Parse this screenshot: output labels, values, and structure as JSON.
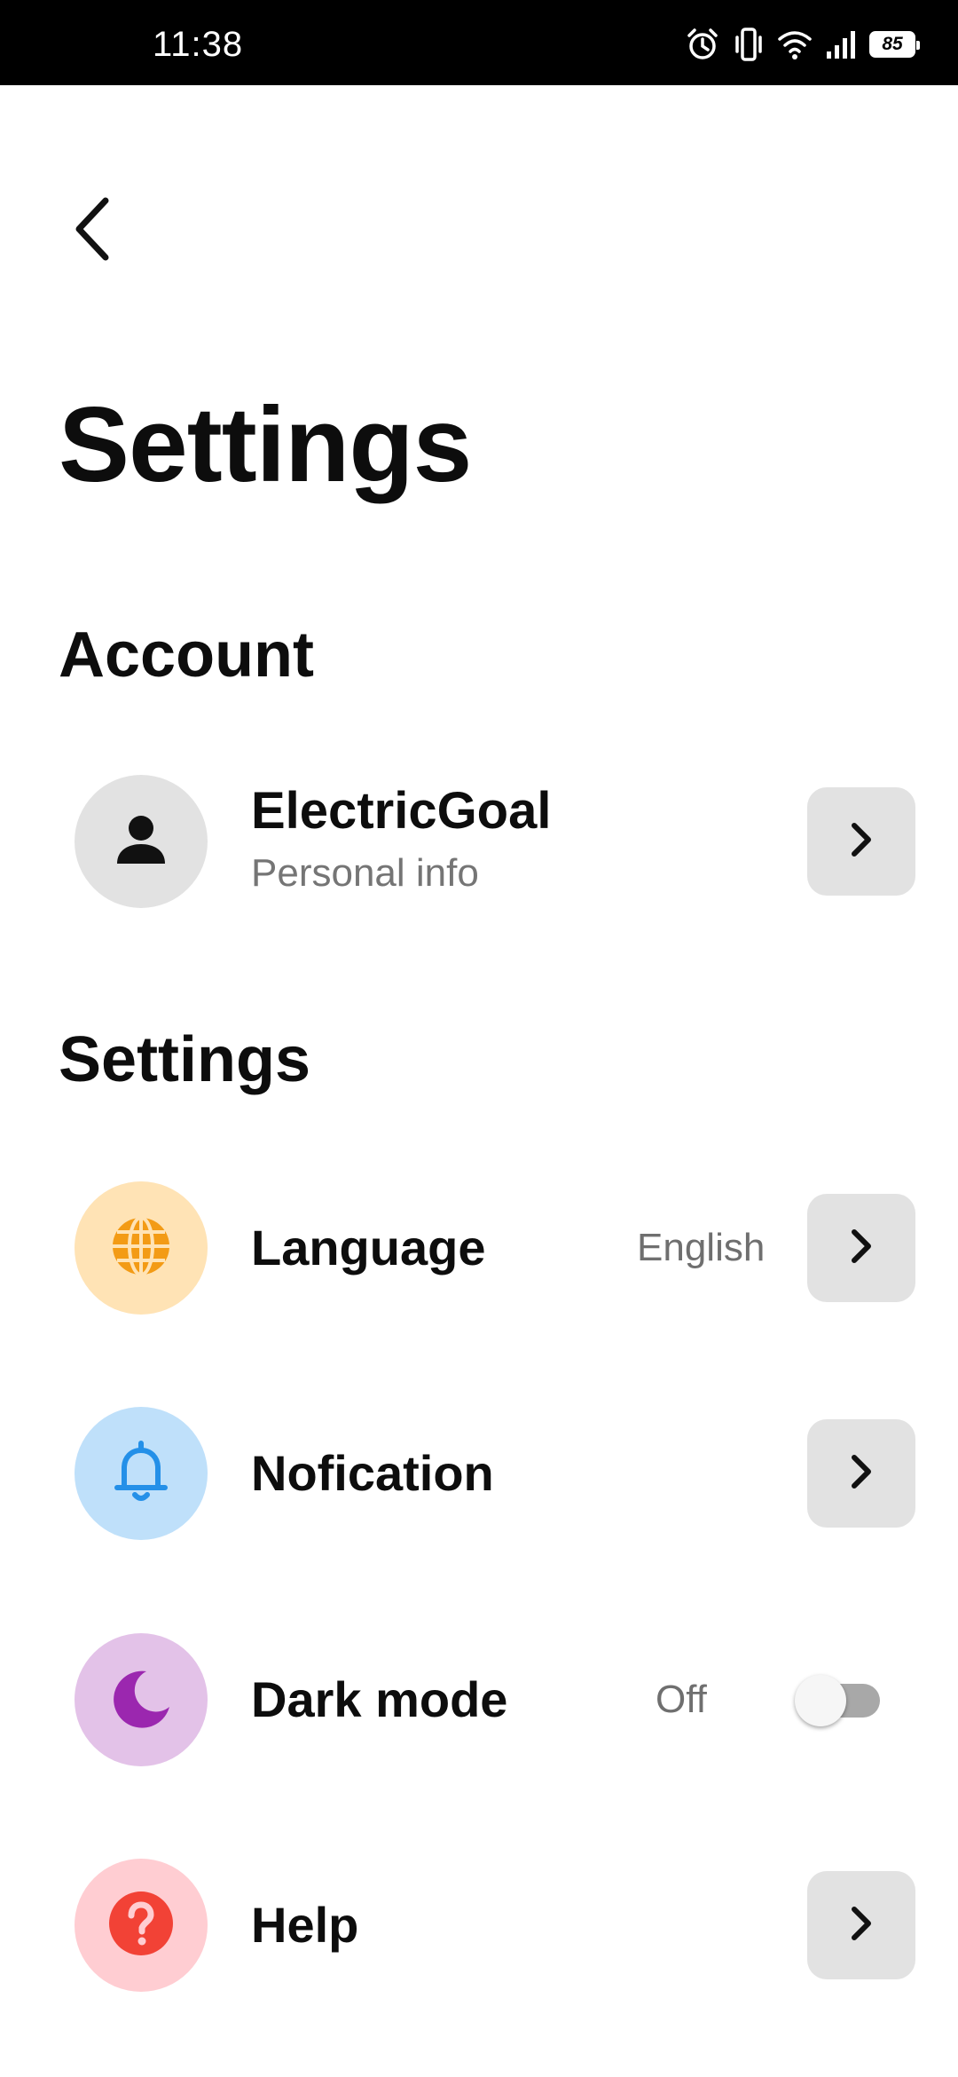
{
  "status_bar": {
    "time": "11:38",
    "battery": "85",
    "icons": [
      "alarm-icon",
      "vibrate-icon",
      "wifi-icon",
      "signal-icon",
      "battery-icon"
    ]
  },
  "header": {
    "back_icon": "chevron-left-icon",
    "title": "Settings"
  },
  "account_section": {
    "title": "Account",
    "profile": {
      "icon": "person-icon",
      "name": "ElectricGoal",
      "subtitle": "Personal info"
    }
  },
  "settings_section": {
    "title": "Settings",
    "items": [
      {
        "label": "Language",
        "value": "English",
        "icon": "globe-icon",
        "icon_bg": "#FFE3B5",
        "icon_color": "#F39B15",
        "control": "chevron"
      },
      {
        "label": "Nofication",
        "icon": "bell-icon",
        "icon_bg": "#BFE0FA",
        "icon_color": "#2490E8",
        "control": "chevron"
      },
      {
        "label": "Dark mode",
        "value": "Off",
        "icon": "moon-icon",
        "icon_bg": "#E3C2E8",
        "icon_color": "#9B27AF",
        "control": "toggle",
        "toggle_on": false
      },
      {
        "label": "Help",
        "icon": "help-icon",
        "icon_bg": "#FFCDD2",
        "icon_color": "#F24236",
        "control": "chevron"
      }
    ]
  },
  "colors": {
    "chevron_button_bg": "#E2E2E2",
    "avatar_bg": "#E2E2E2",
    "secondary_text": "#6F6F6F"
  }
}
